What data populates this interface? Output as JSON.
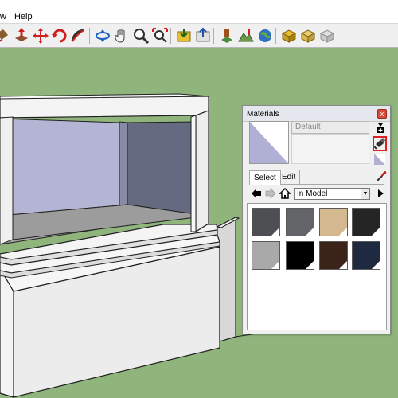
{
  "menubar": {
    "items": [
      {
        "label": "w"
      },
      {
        "label": "Help"
      }
    ]
  },
  "toolbar": {
    "tools": [
      "paint-bucket-icon",
      "push-pull-icon",
      "move-icon",
      "rotate-icon",
      "follow-me-icon",
      "orbit-icon",
      "pan-icon",
      "zoom-icon",
      "zoom-extents-icon",
      "get-models-icon",
      "share-model-icon",
      "add-location-icon",
      "toggle-terrain-icon",
      "preview-google-earth-icon",
      "get-components-icon",
      "share-component-icon",
      "components-icon"
    ]
  },
  "materials": {
    "title": "Materials",
    "close": "x",
    "name_value": "Default",
    "tabs": [
      {
        "label": "Select",
        "active": true
      },
      {
        "label": "Edit",
        "active": false
      }
    ],
    "collection": "In Model",
    "swatches": [
      {
        "color": "#4d4f52"
      },
      {
        "color": "#636467"
      },
      {
        "color": "#d4b88f"
      },
      {
        "color": "#252526"
      },
      {
        "color": "#a9a9a9"
      },
      {
        "color": "#000000"
      },
      {
        "color": "#3a241a"
      },
      {
        "color": "#1f2a40"
      }
    ]
  },
  "colors": {
    "ground": "#8fb57d",
    "highlight": "#e02020"
  }
}
